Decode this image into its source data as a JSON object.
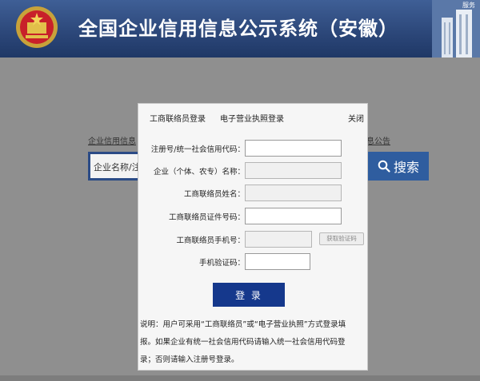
{
  "header": {
    "title": "全国企业信用信息公示系统（安徽）",
    "corner_label": "服务",
    "emblem_icon": "national-emblem-icon"
  },
  "background": {
    "link_left": "企业信用信息",
    "link_right": "息公告",
    "search_placeholder": "企业名称/注",
    "search_button": "搜索",
    "search_icon": "search-icon"
  },
  "modal": {
    "tabs": [
      {
        "label": "工商联络员登录"
      },
      {
        "label": "电子营业执照登录"
      }
    ],
    "close_label": "关闭",
    "fields": [
      {
        "label": "注册号/统一社会信用代码：",
        "value": ""
      },
      {
        "label": "企业（个体、农专）名称：",
        "value": ""
      },
      {
        "label": "工商联络员姓名：",
        "value": ""
      },
      {
        "label": "工商联络员证件号码：",
        "value": ""
      },
      {
        "label": "工商联络员手机号：",
        "value": ""
      },
      {
        "label": "手机验证码：",
        "value": ""
      }
    ],
    "get_code_label": "获取验证码",
    "login_label": "登 录",
    "note": "说明：用户可采用“工商联络员”或“电子营业执照”方式登录填报。如果企业有统一社会信用代码请输入统一社会信用代码登录；否则请输入注册号登录。"
  },
  "colors": {
    "header_bg": "#2b4678",
    "login_button": "#15388c",
    "overlay": "#8f8f8f"
  }
}
